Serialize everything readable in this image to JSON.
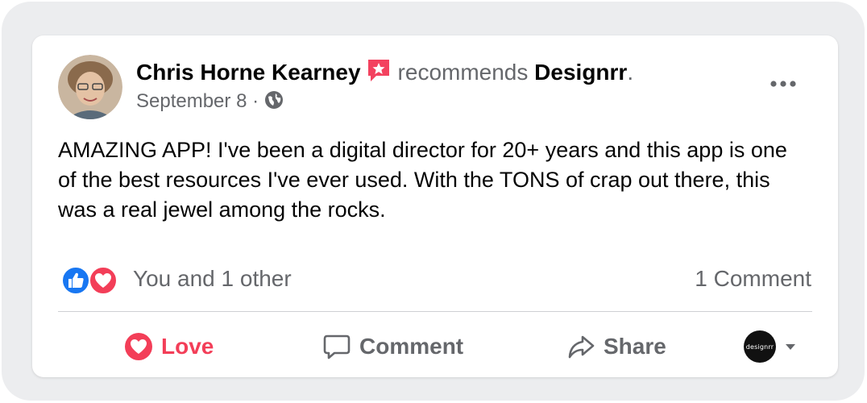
{
  "post": {
    "author": "Chris Horne Kearney",
    "verb": "recommends",
    "page_name": "Designrr",
    "page_name_suffix": ".",
    "date": "September 8",
    "meta_separator": "·",
    "privacy_icon": "globe-icon",
    "recommend_icon": "recommend-star-icon",
    "more_icon": "more-options-icon",
    "body": "AMAZING APP! I've been a digital director for 20+ years and this app is one of the best resources I've ever used. With the TONS of crap out there, this was a real jewel among the rocks."
  },
  "reactions": {
    "icons": [
      "like-reaction-icon",
      "love-reaction-icon"
    ],
    "summary": "You and 1 other",
    "comments": "1 Comment"
  },
  "actions": {
    "love": {
      "label": "Love",
      "icon": "heart-icon",
      "color": "#f33e58"
    },
    "comment": {
      "label": "Comment",
      "icon": "comment-icon"
    },
    "share": {
      "label": "Share",
      "icon": "share-icon"
    },
    "page_switcher": {
      "logo_text": "designrr",
      "icon": "chevron-down-icon"
    }
  },
  "colors": {
    "text_primary": "#050505",
    "text_secondary": "#65676b",
    "love_red": "#f33e58",
    "like_blue": "#1877f2",
    "background": "#ecedef"
  }
}
